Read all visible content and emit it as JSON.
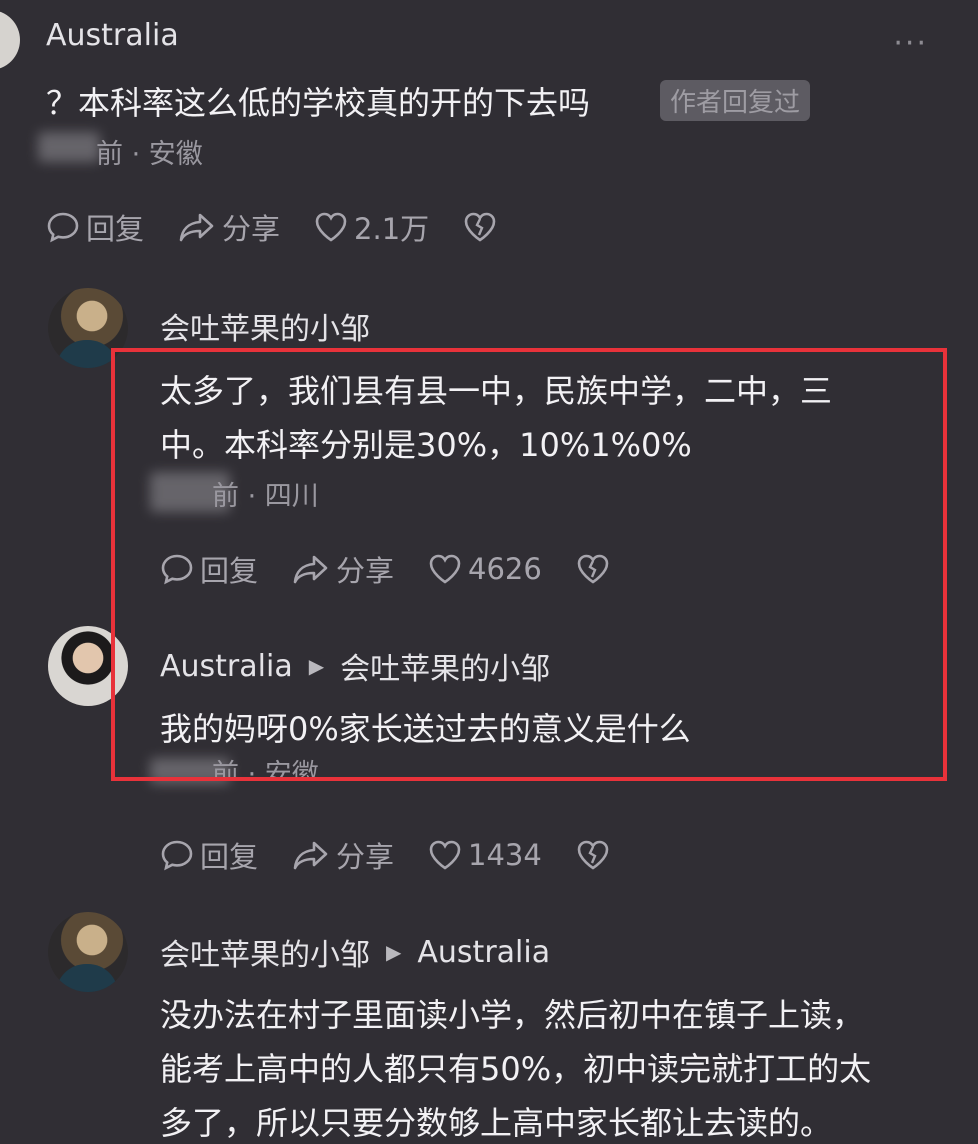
{
  "root_comment": {
    "author": "Australia",
    "text": "？本科率这么低的学校真的开的下去吗",
    "badge": "作者回复过",
    "meta": "前 · 安徽",
    "reply_label": "回复",
    "share_label": "分享",
    "likes": "2.1万"
  },
  "replies": [
    {
      "author": "会吐苹果的小邹",
      "lines": [
        "太多了，我们县有县一中，民族中学，二中，三",
        "中。本科率分别是30%，10%1%0%"
      ],
      "meta": "前 · 四川",
      "reply_label": "回复",
      "share_label": "分享",
      "likes": "4626"
    },
    {
      "author": "Australia",
      "reply_to": "会吐苹果的小邹",
      "lines": [
        "我的妈呀0%家长送过去的意义是什么"
      ],
      "meta": "前 · 安徽",
      "reply_label": "回复",
      "share_label": "分享",
      "likes": "1434"
    },
    {
      "author": "会吐苹果的小邹",
      "reply_to": "Australia",
      "lines": [
        "没办法在村子里面读小学，然后初中在镇子上读，",
        "能考上高中的人都只有50%，初中读完就打工的太",
        "多了，所以只要分数够上高中家长都让去读的。"
      ]
    }
  ],
  "colors": {
    "background": "#302e34",
    "highlight_box": "#e8323a",
    "muted": "#a7a5ad"
  },
  "icons": [
    "comment-icon",
    "share-icon",
    "heart-icon",
    "broken-heart-icon",
    "more-icon"
  ]
}
